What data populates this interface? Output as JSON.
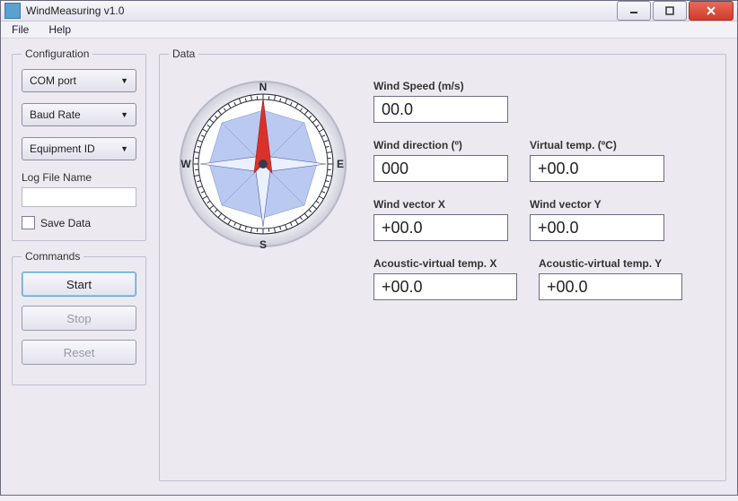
{
  "window": {
    "title": "WindMeasuring v1.0"
  },
  "menu": {
    "file": "File",
    "help": "Help"
  },
  "config": {
    "legend": "Configuration",
    "com_port": "COM port",
    "baud_rate": "Baud Rate",
    "equipment_id": "Equipment ID",
    "log_file_label": "Log File Name",
    "log_file_value": "",
    "save_data": "Save Data"
  },
  "commands": {
    "legend": "Commands",
    "start": "Start",
    "stop": "Stop",
    "reset": "Reset"
  },
  "data": {
    "legend": "Data",
    "cardinals": {
      "n": "N",
      "e": "E",
      "s": "S",
      "w": "W"
    },
    "wind_speed_label": "Wind Speed (m/s)",
    "wind_speed": "00.0",
    "wind_dir_label": "Wind direction (º)",
    "wind_dir": "000",
    "virtual_temp_label": "Virtual temp. (ºC)",
    "virtual_temp": "+00.0",
    "wind_vec_x_label": "Wind vector X",
    "wind_vec_x": "+00.0",
    "wind_vec_y_label": "Wind vector Y",
    "wind_vec_y": "+00.0",
    "acoustic_x_label": "Acoustic-virtual temp. X",
    "acoustic_x": "+00.0",
    "acoustic_y_label": "Acoustic-virtual temp. Y",
    "acoustic_y": "+00.0"
  }
}
